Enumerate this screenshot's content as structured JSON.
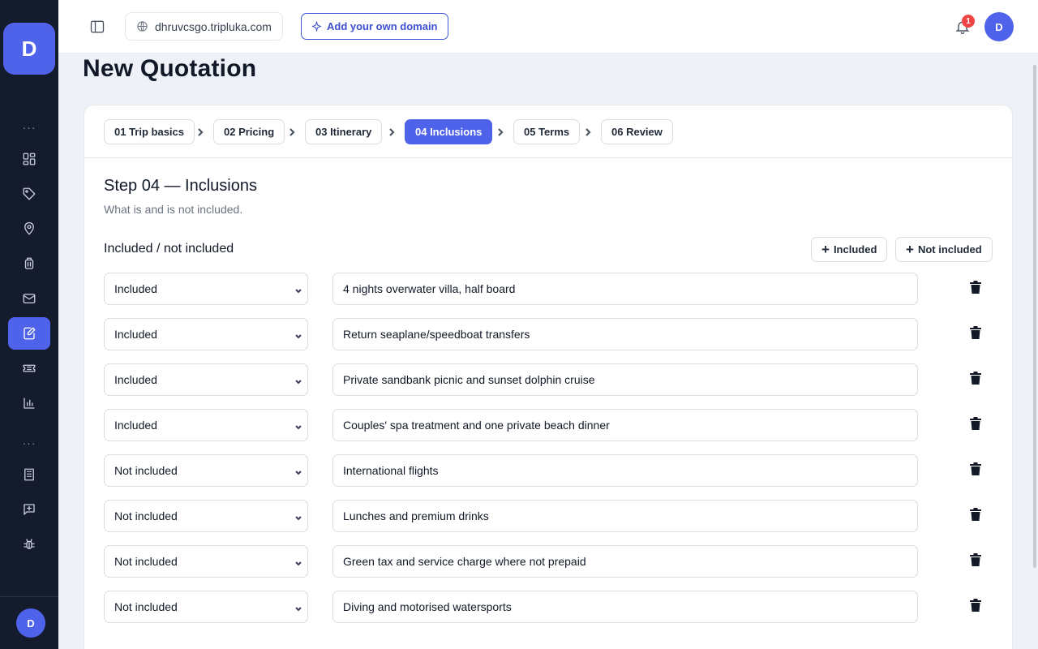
{
  "app": {
    "logo_letter": "D",
    "user_initial": "D"
  },
  "topbar": {
    "domain": "dhruvcsgo.tripluka.com",
    "add_domain_label": "Add your own domain",
    "notification_count": "1"
  },
  "sidebar": {
    "items": [
      {
        "icon": "dashboard-icon"
      },
      {
        "icon": "tag-icon"
      },
      {
        "icon": "map-pin-icon"
      },
      {
        "icon": "luggage-icon"
      },
      {
        "icon": "mail-icon"
      },
      {
        "icon": "edit-document-icon",
        "active": true
      },
      {
        "icon": "ticket-icon"
      },
      {
        "icon": "bar-chart-icon"
      },
      {
        "icon": "building-icon"
      },
      {
        "icon": "message-plus-icon"
      },
      {
        "icon": "bug-icon"
      }
    ]
  },
  "page": {
    "title": "New Quotation"
  },
  "steps": [
    {
      "label": "01 Trip basics"
    },
    {
      "label": "02 Pricing"
    },
    {
      "label": "03 Itinerary"
    },
    {
      "label": "04 Inclusions",
      "active": true
    },
    {
      "label": "05 Terms"
    },
    {
      "label": "06 Review"
    }
  ],
  "form": {
    "heading": "Step 04 — Inclusions",
    "subheading": "What is and is not included.",
    "section_title": "Included / not included",
    "add_included_label": "Included",
    "add_not_included_label": "Not included",
    "rows": [
      {
        "status": "Included",
        "text": "4 nights overwater villa, half board"
      },
      {
        "status": "Included",
        "text": "Return seaplane/speedboat transfers"
      },
      {
        "status": "Included",
        "text": "Private sandbank picnic and sunset dolphin cruise"
      },
      {
        "status": "Included",
        "text": "Couples' spa treatment and one private beach dinner"
      },
      {
        "status": "Not included",
        "text": "International flights"
      },
      {
        "status": "Not included",
        "text": "Lunches and premium drinks"
      },
      {
        "status": "Not included",
        "text": "Green tax and service charge where not prepaid"
      },
      {
        "status": "Not included",
        "text": "Diving and motorised watersports"
      }
    ]
  },
  "colors": {
    "accent": "#4f63ea",
    "sidebar_bg": "#141b2d",
    "badge": "#ef4444"
  }
}
